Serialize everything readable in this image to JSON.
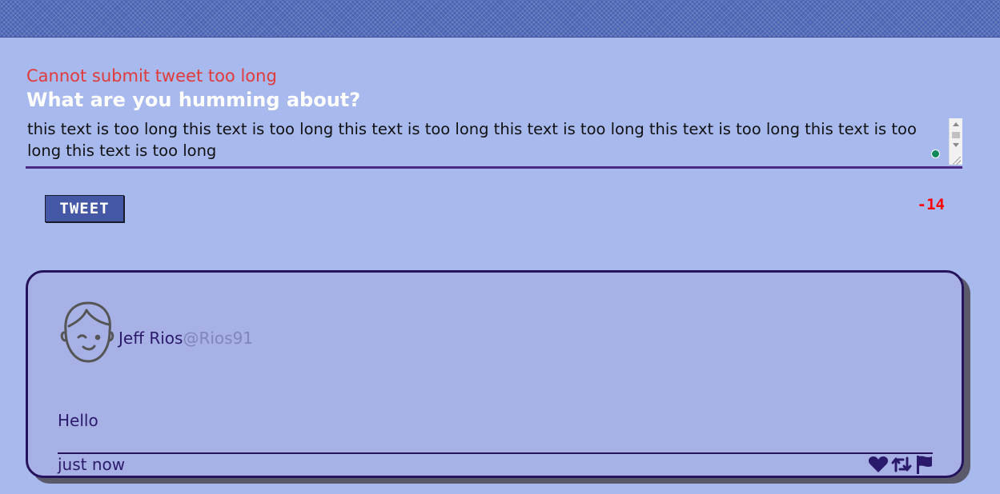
{
  "colors": {
    "background": "#a8b9ee",
    "header": "#4a63b3",
    "error": "#e03b3b",
    "accent": "#4b2a85",
    "button": "#4458a6",
    "counter": "#ff0000",
    "card": "#a8b1e6",
    "card_border": "#26135d",
    "handle": "#7f87b8"
  },
  "compose": {
    "error_message": "Cannot submit tweet too long",
    "prompt": "What are you humming about?",
    "text": "this text is too long this text is too long this text is too long this text is too long this text is too long this text is too long this text is too long",
    "tweet_button_label": "TWEET",
    "char_counter": "-14"
  },
  "tweet": {
    "author_name": "Jeff Rios",
    "author_handle": "@Rios91",
    "content": "Hello",
    "timestamp": "just now",
    "actions": [
      {
        "icon": "heart-icon"
      },
      {
        "icon": "retweet-icon"
      },
      {
        "icon": "flag-icon"
      }
    ],
    "avatar_icon": "avatar-face-icon"
  }
}
